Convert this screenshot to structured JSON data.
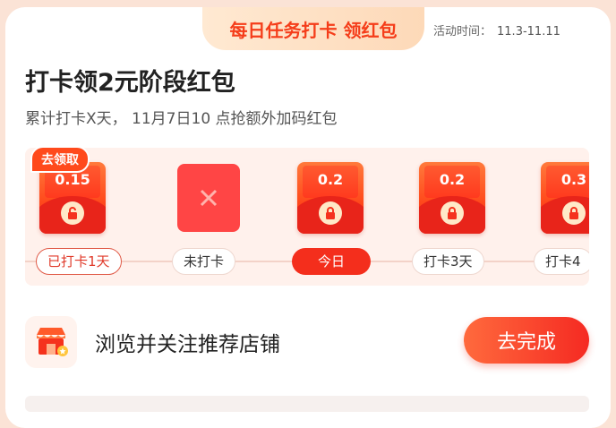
{
  "banner": {
    "title": "每日任务打卡 领红包",
    "period_label": "活动时间：",
    "period_dates": "11.3-11.11"
  },
  "header": {
    "title": "打卡领2元阶段红包",
    "subtitle": "累计打卡X天， 11月7日10 点抢额外加码红包"
  },
  "track": {
    "claim_tag": "去领取",
    "days": [
      {
        "value": "0.15",
        "label": "已打卡1天",
        "state": "done"
      },
      {
        "value": "",
        "label": "未打卡",
        "state": "missed"
      },
      {
        "value": "0.2",
        "label": "今日",
        "state": "today"
      },
      {
        "value": "0.2",
        "label": "打卡3天",
        "state": "locked"
      },
      {
        "value": "0.3",
        "label": "打卡4",
        "state": "locked"
      }
    ]
  },
  "task": {
    "label": "浏览并关注推荐店铺",
    "button": "去完成",
    "icon": "shop-icon"
  },
  "colors": {
    "accent": "#f42e1c",
    "envelope": "#ff4a1c",
    "missed": "#ff4545",
    "background": "#fbe3d6"
  }
}
